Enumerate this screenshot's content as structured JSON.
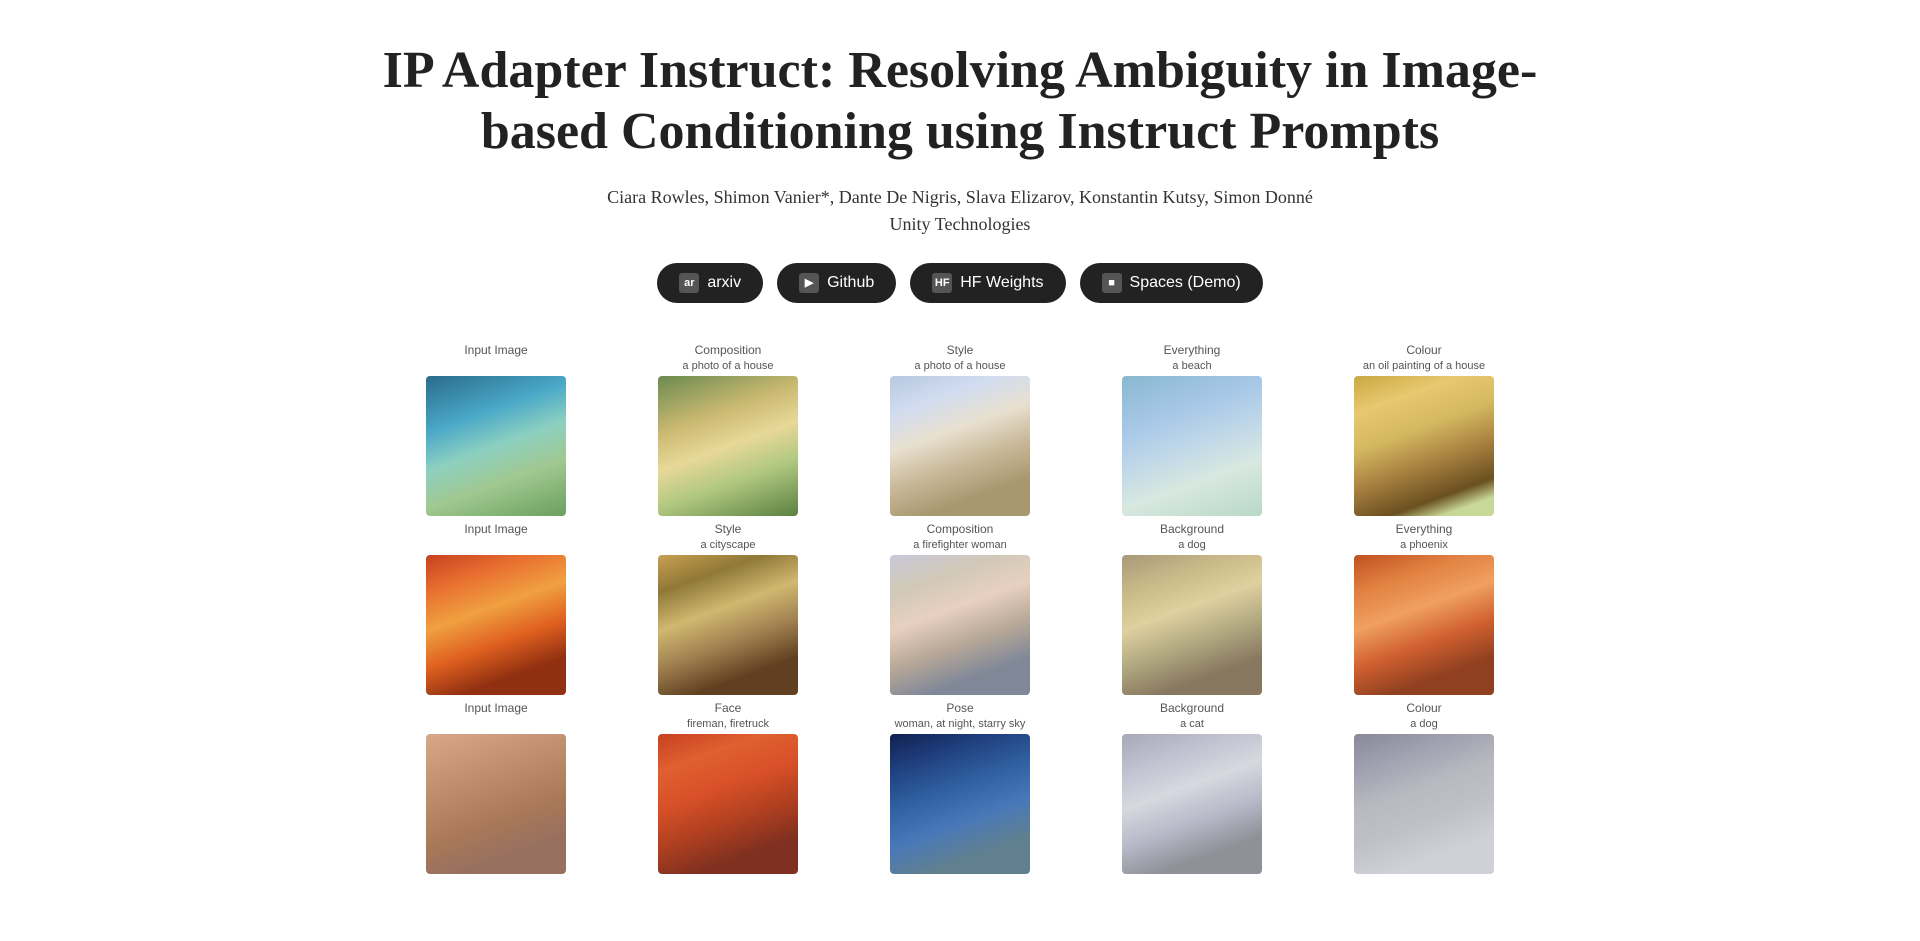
{
  "title": "IP Adapter Instruct: Resolving Ambiguity in Image-based Conditioning using Instruct Prompts",
  "authors": "Ciara Rowles, Shimon Vanier*, Dante De Nigris, Slava Elizarov, Konstantin Kutsy, Simon Donné",
  "affiliation": "Unity Technologies",
  "buttons": [
    {
      "label": "arxiv",
      "icon": "pdf"
    },
    {
      "label": "Github",
      "icon": "pdf"
    },
    {
      "label": "HF Weights",
      "icon": "pdf"
    },
    {
      "label": "Spaces (Demo)",
      "icon": "pdf"
    }
  ],
  "grid": {
    "rows": [
      {
        "columns": [
          {
            "header": "Input Image",
            "subheader": ""
          },
          {
            "header": "Composition",
            "subheader": "a photo of a house"
          },
          {
            "header": "Style",
            "subheader": "a photo of a house"
          },
          {
            "header": "Everything",
            "subheader": "a beach"
          },
          {
            "header": "Colour",
            "subheader": "an oil painting of a house"
          }
        ]
      },
      {
        "columns": [
          {
            "header": "Input Image",
            "subheader": ""
          },
          {
            "header": "Style",
            "subheader": "a cityscape"
          },
          {
            "header": "Composition",
            "subheader": "a firefighter woman"
          },
          {
            "header": "Background",
            "subheader": "a dog"
          },
          {
            "header": "Everything",
            "subheader": "a phoenix"
          }
        ]
      },
      {
        "columns": [
          {
            "header": "Input Image",
            "subheader": ""
          },
          {
            "header": "Face",
            "subheader": "fireman, firetruck"
          },
          {
            "header": "Pose",
            "subheader": "woman, at night, starry sky"
          },
          {
            "header": "Background",
            "subheader": "a cat"
          },
          {
            "header": "Colour",
            "subheader": "a dog"
          }
        ]
      }
    ]
  }
}
